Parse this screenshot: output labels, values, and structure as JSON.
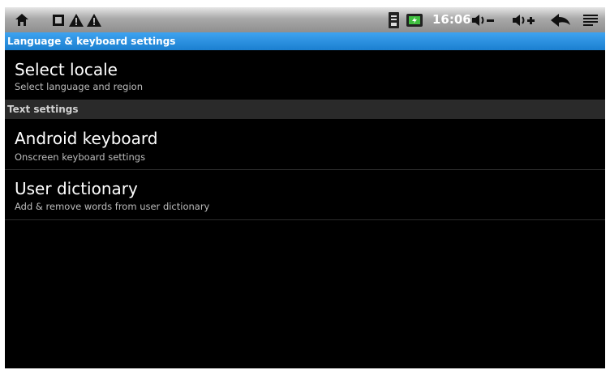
{
  "status_bar": {
    "left_icons": [
      "home-icon",
      "sd-card-icon",
      "warning-icon",
      "warning-icon"
    ],
    "right_icons": [
      "signal-icon",
      "battery-charging-icon",
      "volume-down-icon",
      "volume-up-icon",
      "back-icon",
      "menu-icon"
    ],
    "time": "16:06"
  },
  "title": "Language & keyboard settings",
  "items": [
    {
      "title": "Select locale",
      "summary": "Select language and region"
    }
  ],
  "section_header": "Text settings",
  "text_items": [
    {
      "title": "Android keyboard",
      "summary": "Onscreen keyboard settings"
    },
    {
      "title": "User dictionary",
      "summary": "Add & remove words from user dictionary"
    }
  ],
  "colors": {
    "title_bar": "#2a8fe0",
    "background": "#000000",
    "status_bar": "#a9a9a9"
  }
}
